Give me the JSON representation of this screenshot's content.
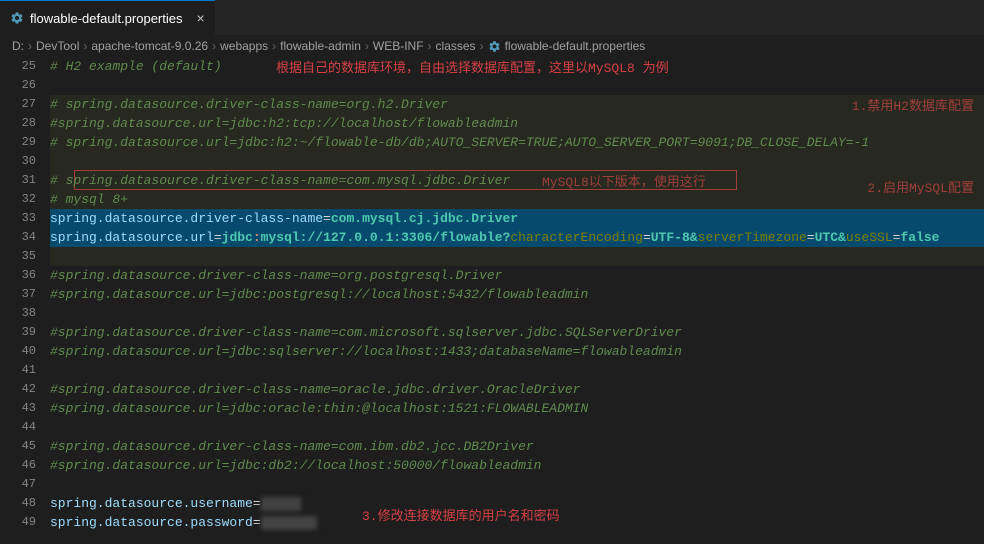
{
  "tab": {
    "title": "flowable-default.properties"
  },
  "breadcrumbs": [
    "D:",
    "DevTool",
    "apache-tomcat-9.0.26",
    "webapps",
    "flowable-admin",
    "WEB-INF",
    "classes",
    "flowable-default.properties"
  ],
  "annotations": {
    "top": "根据自己的数据库环境，自由选择数据库配置，这里以MySQL8 为例",
    "right1": "1.禁用H2数据库配置",
    "right2": "2.启用MySQL配置",
    "inline": "MySQL8以下版本，使用这行",
    "bottom": "3.修改连接数据库的用户名和密码"
  },
  "lines": {
    "25": "# H2 example (default)",
    "27": "# spring.datasource.driver-class-name=org.h2.Driver",
    "28": "#spring.datasource.url=jdbc:h2:tcp://localhost/flowableadmin",
    "29": "# spring.datasource.url=jdbc:h2:~/flowable-db/db;AUTO_SERVER=TRUE;AUTO_SERVER_PORT=9091;DB_CLOSE_DELAY=-1",
    "31_c": "# spring.datasource.driver-class-name=com.mysql.jdbc.Driver",
    "32": "# mysql 8+",
    "33_key": "spring.datasource.driver-class-name",
    "33_val": "com.mysql.cj.jdbc.Driver",
    "34_key": "spring.datasource.url",
    "34_p1": "jdbc",
    "34_p2": ":",
    "34_p3": "mysql://127.0.0.1:3306/flowable?",
    "34_p4": "characterEncoding",
    "34_p5": "UTF-8",
    "34_p6": "&",
    "34_p7": "serverTimezone",
    "34_p8": "UTC",
    "34_p9": "&",
    "34_p10": "useSSL",
    "34_p11": "false",
    "36": "#spring.datasource.driver-class-name=org.postgresql.Driver",
    "37": "#spring.datasource.url=jdbc:postgresql://localhost:5432/flowableadmin",
    "39": "#spring.datasource.driver-class-name=com.microsoft.sqlserver.jdbc.SQLServerDriver",
    "40": "#spring.datasource.url=jdbc:sqlserver://localhost:1433;databaseName=flowableadmin",
    "42": "#spring.datasource.driver-class-name=oracle.jdbc.driver.OracleDriver",
    "43": "#spring.datasource.url=jdbc:oracle:thin:@localhost:1521:FLOWABLEADMIN",
    "45": "#spring.datasource.driver-class-name=com.ibm.db2.jcc.DB2Driver",
    "46": "#spring.datasource.url=jdbc:db2://localhost:50000/flowableadmin",
    "48_key": "spring.datasource.username",
    "49_key": "spring.datasource.password"
  }
}
